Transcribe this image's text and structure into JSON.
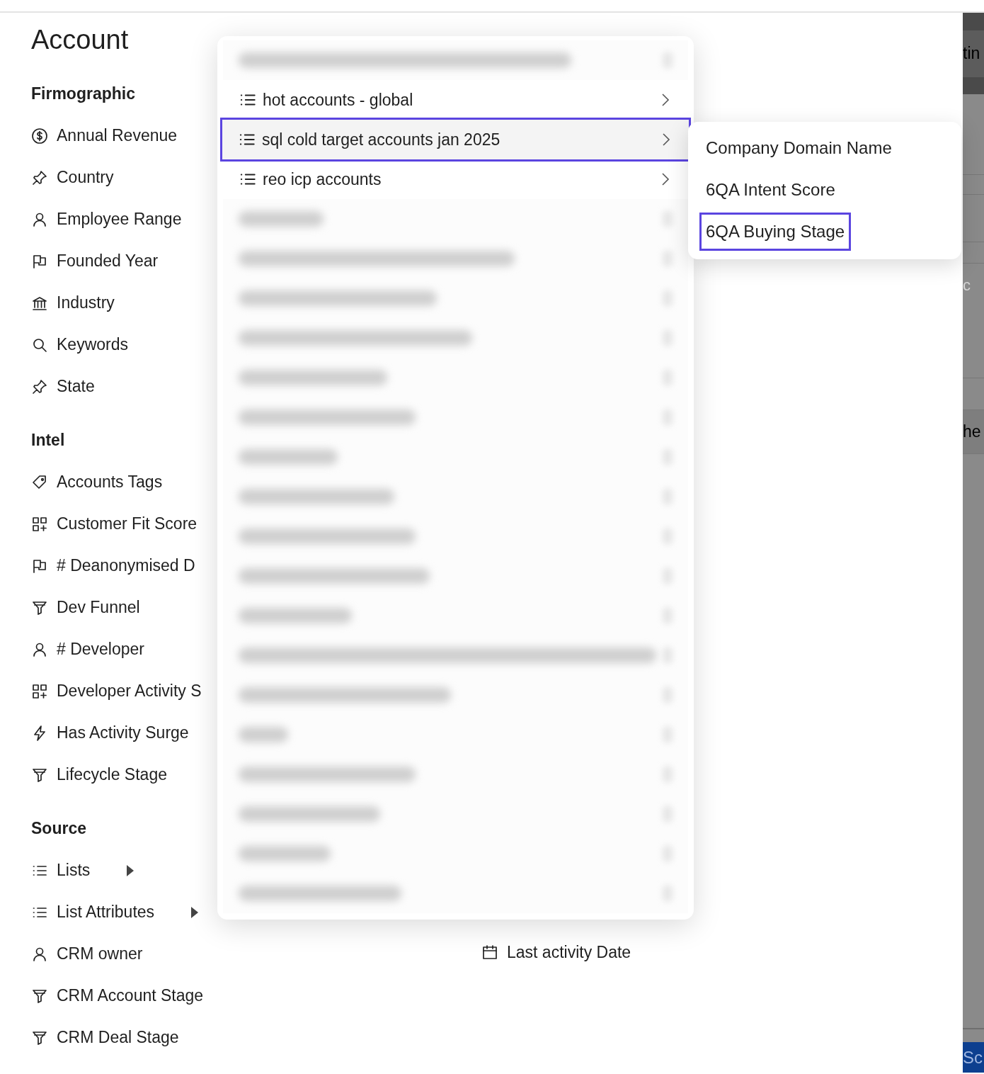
{
  "sidebar": {
    "title": "Account",
    "sections": [
      {
        "heading": "Firmographic",
        "items": [
          {
            "label": "Annual Revenue",
            "has_submenu": false
          },
          {
            "label": "Country",
            "has_submenu": false
          },
          {
            "label": "Employee Range",
            "has_submenu": false
          },
          {
            "label": "Founded Year",
            "has_submenu": false
          },
          {
            "label": "Industry",
            "has_submenu": false
          },
          {
            "label": "Keywords",
            "has_submenu": false
          },
          {
            "label": "State",
            "has_submenu": false
          }
        ]
      },
      {
        "heading": "Intel",
        "items": [
          {
            "label": "Accounts Tags",
            "has_submenu": false
          },
          {
            "label": "Customer Fit Score",
            "has_submenu": false
          },
          {
            "label": "# Deanonymised D",
            "has_submenu": false
          },
          {
            "label": "Dev Funnel",
            "has_submenu": false
          },
          {
            "label": "# Developer",
            "has_submenu": false
          },
          {
            "label": "Developer Activity S",
            "has_submenu": false
          },
          {
            "label": "Has Activity Surge",
            "has_submenu": false
          },
          {
            "label": "Lifecycle Stage",
            "has_submenu": false
          }
        ]
      },
      {
        "heading": "Source",
        "items": [
          {
            "label": "Lists",
            "has_submenu": true
          },
          {
            "label": "List Attributes",
            "has_submenu": true
          },
          {
            "label": "CRM owner",
            "has_submenu": false
          },
          {
            "label": "CRM Account Stage",
            "has_submenu": false
          },
          {
            "label": "CRM Deal Stage",
            "has_submenu": false
          }
        ]
      }
    ]
  },
  "activity": {
    "items": [
      {
        "label": "Last activity Date"
      }
    ]
  },
  "lists_menu": {
    "items": [
      {
        "kind": "redacted",
        "selected": false
      },
      {
        "kind": "list",
        "label": "hot accounts - global",
        "selected": false
      },
      {
        "kind": "list",
        "label": "sql cold target accounts jan 2025",
        "selected": true
      },
      {
        "kind": "list",
        "label": "reo icp accounts",
        "selected": false
      },
      {
        "kind": "redacted",
        "selected": false
      },
      {
        "kind": "redacted",
        "selected": false
      },
      {
        "kind": "redacted",
        "selected": false
      },
      {
        "kind": "redacted",
        "selected": false
      },
      {
        "kind": "redacted",
        "selected": false
      },
      {
        "kind": "redacted",
        "selected": false
      },
      {
        "kind": "redacted",
        "selected": false
      },
      {
        "kind": "redacted",
        "selected": false
      },
      {
        "kind": "redacted",
        "selected": false
      },
      {
        "kind": "redacted",
        "selected": false
      },
      {
        "kind": "redacted",
        "selected": false
      },
      {
        "kind": "redacted",
        "selected": false
      },
      {
        "kind": "redacted",
        "selected": false
      },
      {
        "kind": "redacted",
        "selected": false
      },
      {
        "kind": "redacted",
        "selected": false
      },
      {
        "kind": "redacted",
        "selected": false
      },
      {
        "kind": "redacted",
        "selected": false
      },
      {
        "kind": "redacted",
        "selected": false
      }
    ]
  },
  "attributes_menu": {
    "items": [
      {
        "label": "Company Domain Name",
        "selected": false
      },
      {
        "label": "6QA Intent Score",
        "selected": false
      },
      {
        "label": "6QA Buying Stage",
        "selected": true
      }
    ]
  },
  "background_panel": {
    "texts": [
      "tin",
      "c",
      "he"
    ],
    "button": "Sc"
  }
}
